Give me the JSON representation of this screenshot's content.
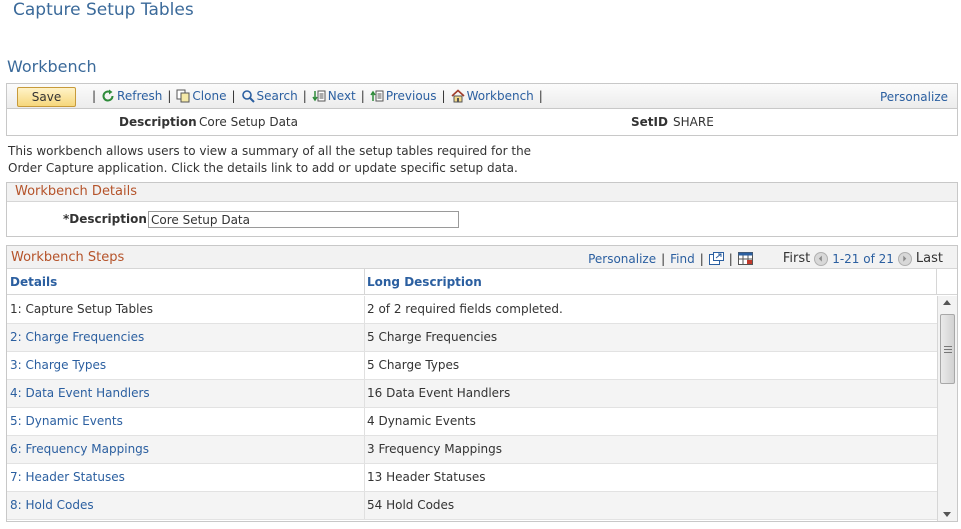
{
  "page": {
    "title": "Capture Setup Tables",
    "section_title": "Workbench"
  },
  "toolbar": {
    "save_label": "Save",
    "items": [
      "Refresh",
      "Clone",
      "Search",
      "Next",
      "Previous",
      "Workbench"
    ],
    "separator": "|",
    "personalize": "Personalize"
  },
  "header_info": {
    "description_label": "Description",
    "description_value": "Core Setup Data",
    "setid_label": "SetID",
    "setid_value": "SHARE"
  },
  "intro_text": "This workbench allows users to view a summary of all the setup tables required for the Order Capture application. Click the details link to add or update specific setup data.",
  "workbench_details": {
    "title": "Workbench Details",
    "description_label": "*Description",
    "description_value": "Core Setup Data"
  },
  "workbench_steps": {
    "title": "Workbench Steps",
    "personalize": "Personalize",
    "find": "Find",
    "first": "First",
    "range": "1-21 of 21",
    "last": "Last",
    "columns": [
      "Details",
      "Long Description"
    ],
    "rows": [
      {
        "details": "1: Capture Setup Tables",
        "long": "2 of 2 required fields completed."
      },
      {
        "details": "2: Charge Frequencies",
        "long": "5 Charge Frequencies"
      },
      {
        "details": "3: Charge Types",
        "long": "5 Charge Types"
      },
      {
        "details": "4: Data Event Handlers",
        "long": "16 Data Event Handlers"
      },
      {
        "details": "5: Dynamic Events",
        "long": "4 Dynamic Events"
      },
      {
        "details": "6: Frequency Mappings",
        "long": "3 Frequency Mappings"
      },
      {
        "details": "7: Header Statuses",
        "long": "13 Header Statuses"
      },
      {
        "details": "8: Hold Codes",
        "long": "54 Hold Codes"
      }
    ]
  },
  "colors": {
    "link": "#2b5fa0",
    "title": "#3b6a9a",
    "group_header": "#b5532a"
  }
}
